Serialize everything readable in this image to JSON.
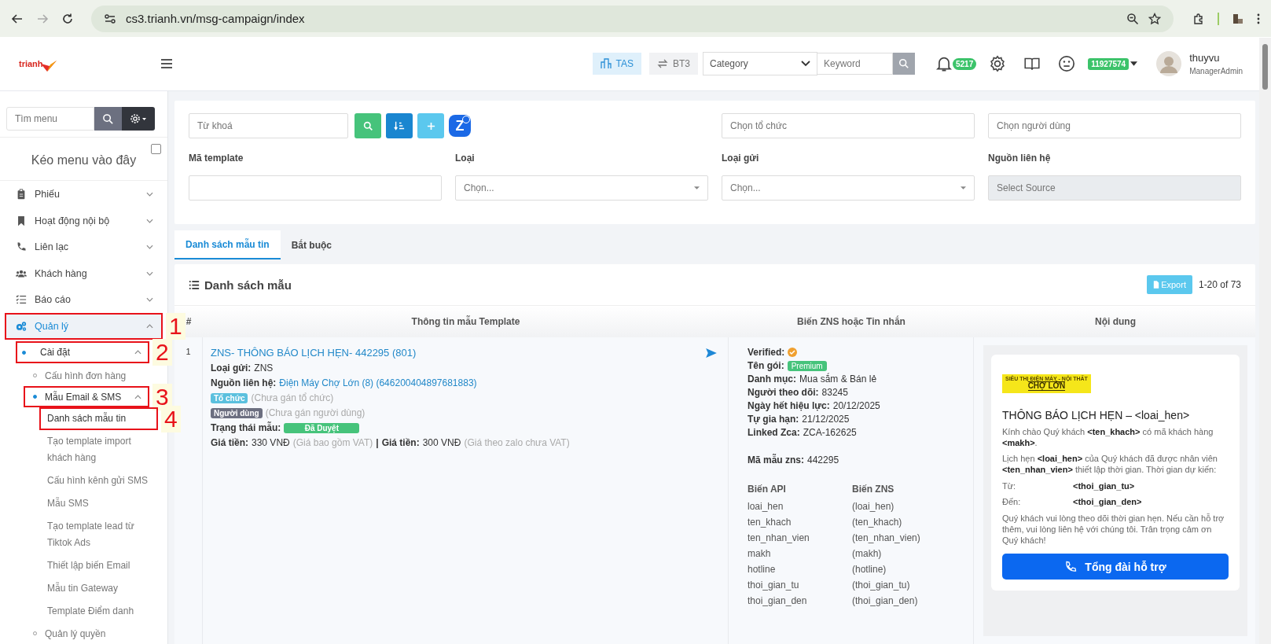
{
  "browser": {
    "url": "cs3.trianh.vn/msg-campaign/index"
  },
  "header": {
    "brand": "trianh",
    "chips": [
      {
        "label": "TAS",
        "selected": true
      },
      {
        "label": "BT3",
        "selected": false
      }
    ],
    "category_select": {
      "value": "Category"
    },
    "keyword": {
      "placeholder": "Keyword"
    },
    "notifications": "5217",
    "balance": "11927574",
    "user": {
      "name": "thuyvu",
      "role": "ManagerAdmin"
    }
  },
  "sidebar": {
    "search": {
      "placeholder": "Tìm menu"
    },
    "drop_zone": "Kéo menu vào đây",
    "drop_checkbox": {
      "checked": false
    },
    "items": [
      {
        "kind": "clipboard",
        "label": "Phiếu",
        "active": false,
        "expanded": false
      },
      {
        "kind": "bookmark",
        "label": "Hoạt động nội bộ",
        "active": false,
        "expanded": false
      },
      {
        "kind": "phone",
        "label": "Liên lạc",
        "active": false,
        "expanded": false
      },
      {
        "kind": "users",
        "label": "Khách hàng",
        "active": false,
        "expanded": false
      },
      {
        "kind": "list",
        "label": "Báo cáo",
        "active": false,
        "expanded": false
      },
      {
        "kind": "cogs",
        "label": "Quản lý",
        "active": true,
        "expanded": true,
        "annotation": "1",
        "children": [
          {
            "label": "Cài đặt",
            "active": true,
            "expanded": true,
            "annotation": "2",
            "children": [
              {
                "label": "Cấu hình đơn hàng",
                "active": false
              },
              {
                "label": "Mẫu Email & SMS",
                "active": true,
                "expanded": true,
                "annotation": "3",
                "children": [
                  {
                    "label": "Danh sách mẫu tin",
                    "selected": true,
                    "annotation": "4"
                  },
                  {
                    "label": "Tạo template import khách hàng",
                    "selected": false
                  },
                  {
                    "label": "Cấu hình kênh gửi SMS",
                    "selected": false
                  },
                  {
                    "label": "Mẫu SMS",
                    "selected": false
                  },
                  {
                    "label": "Tạo template lead từ Tiktok Ads",
                    "selected": false
                  },
                  {
                    "label": "Thiết lập biến Email",
                    "selected": false
                  },
                  {
                    "label": "Mẫu tin Gateway",
                    "selected": false
                  },
                  {
                    "label": "Template Điểm danh",
                    "selected": false
                  }
                ]
              },
              {
                "label": "Quản lý quyền",
                "active": false
              }
            ]
          }
        ]
      }
    ]
  },
  "filters": {
    "keyword": {
      "placeholder": "Từ khoá"
    },
    "zalo_button": "Z",
    "organization": {
      "placeholder": "Chọn tổ chức"
    },
    "user": {
      "placeholder": "Chọn người dùng"
    },
    "fields": [
      {
        "label": "Mã template",
        "kind": "input",
        "disabled": false
      },
      {
        "label": "Loại",
        "kind": "select",
        "placeholder": "Chọn...",
        "disabled": false
      },
      {
        "label": "Loại gửi",
        "kind": "select",
        "placeholder": "Chọn...",
        "disabled": false
      },
      {
        "label": "Nguồn liên hệ",
        "kind": "input",
        "placeholder": "Select Source",
        "disabled": true
      }
    ]
  },
  "tabs": [
    {
      "label": "Danh sách mẫu tin",
      "selected": true
    },
    {
      "label": "Bắt buộc",
      "selected": false
    }
  ],
  "list": {
    "title": "Danh sách mẫu",
    "export": "Export",
    "count": "1-20 of 73",
    "columns": [
      "#",
      "Thông tin mẫu Template",
      "Biến ZNS hoặc Tin nhắn",
      "Nội dung"
    ],
    "rows": [
      {
        "index": "1",
        "title": "ZNS- THÔNG BÁO LỊCH HẸN- 442295 (801)",
        "info": [
          {
            "label": "Loại gửi:",
            "value": "ZNS",
            "kind": "text"
          },
          {
            "label": "Nguồn liên hệ:",
            "value": "Điện Máy Chợ Lớn (8) (646200404897681883)",
            "kind": "link"
          }
        ],
        "tags": [
          {
            "label": "Tổ chức",
            "note": "(Chưa gán tổ chức)",
            "color": "#5bc0de"
          },
          {
            "label": "Người dùng",
            "note": "(Chưa gán người dùng)",
            "color": "#6c6f80"
          }
        ],
        "status": {
          "label": "Trạng thái mẫu:",
          "value": "Đã Duyệt"
        },
        "prices": [
          {
            "label": "Giá tiền:",
            "value": "330 VNĐ",
            "note": "(Giá bao gồm VAT)"
          },
          {
            "label": "Giá tiền:",
            "value": "300 VNĐ",
            "note": "(Giá theo zalo chưa VAT)"
          }
        ],
        "price_separator": "|",
        "zns": {
          "verified": {
            "label": "Verified:",
            "verified": true
          },
          "package": {
            "label": "Tên gói:",
            "value": "Premium"
          },
          "details": [
            {
              "label": "Danh mục:",
              "value": "Mua sắm & Bán lẻ"
            },
            {
              "label": "Người theo dõi:",
              "value": "83245"
            },
            {
              "label": "Ngày hết hiệu lực:",
              "value": "20/12/2025"
            },
            {
              "label": "Tự gia hạn:",
              "value": "21/12/2025"
            },
            {
              "label": "Linked Zca:",
              "value": "ZCA-162625"
            }
          ],
          "code": {
            "label": "Mã mẫu zns:",
            "value": "442295"
          },
          "var_headers": [
            "Biến API",
            "Biến ZNS"
          ],
          "vars": [
            {
              "api": "loai_hen",
              "zns": "(loai_hen)"
            },
            {
              "api": "ten_khach",
              "zns": "(ten_khach)"
            },
            {
              "api": "ten_nhan_vien",
              "zns": "(ten_nhan_vien)"
            },
            {
              "api": "makh",
              "zns": "(makh)"
            },
            {
              "api": "hotline",
              "zns": "(hotline)"
            },
            {
              "api": "thoi_gian_tu",
              "zns": "(thoi_gian_tu)"
            },
            {
              "api": "thoi_gian_den",
              "zns": "(thoi_gian_den)"
            }
          ]
        },
        "preview": {
          "logo_tagline": "SIÊU THỊ ĐIỆN MÁY - NỘI THẤT",
          "logo_name": "CHỢ LỚN",
          "title": "THÔNG BÁO LỊCH HẸN – <loai_hen>",
          "paragraphs": [
            "Kính chào Quý khách **<ten_khach>** có mã khách hàng **<makh>**.",
            "Lịch hẹn **<loai_hen>** của Quý khách đã được nhân viên **<ten_nhan_vien>** thiết lập thời gian. Thời gian dự kiến:"
          ],
          "times": [
            {
              "label": "Từ:",
              "value": "<thoi_gian_tu>"
            },
            {
              "label": "Đến:",
              "value": "<thoi_gian_den>"
            }
          ],
          "closing": "Quý khách vui lòng theo dõi thời gian hẹn. Nếu cần hỗ trợ thêm, vui lòng liên hệ với chúng tôi. Trân trọng cảm ơn Quý khách!",
          "button": "Tổng đài hỗ trợ"
        }
      }
    ]
  }
}
